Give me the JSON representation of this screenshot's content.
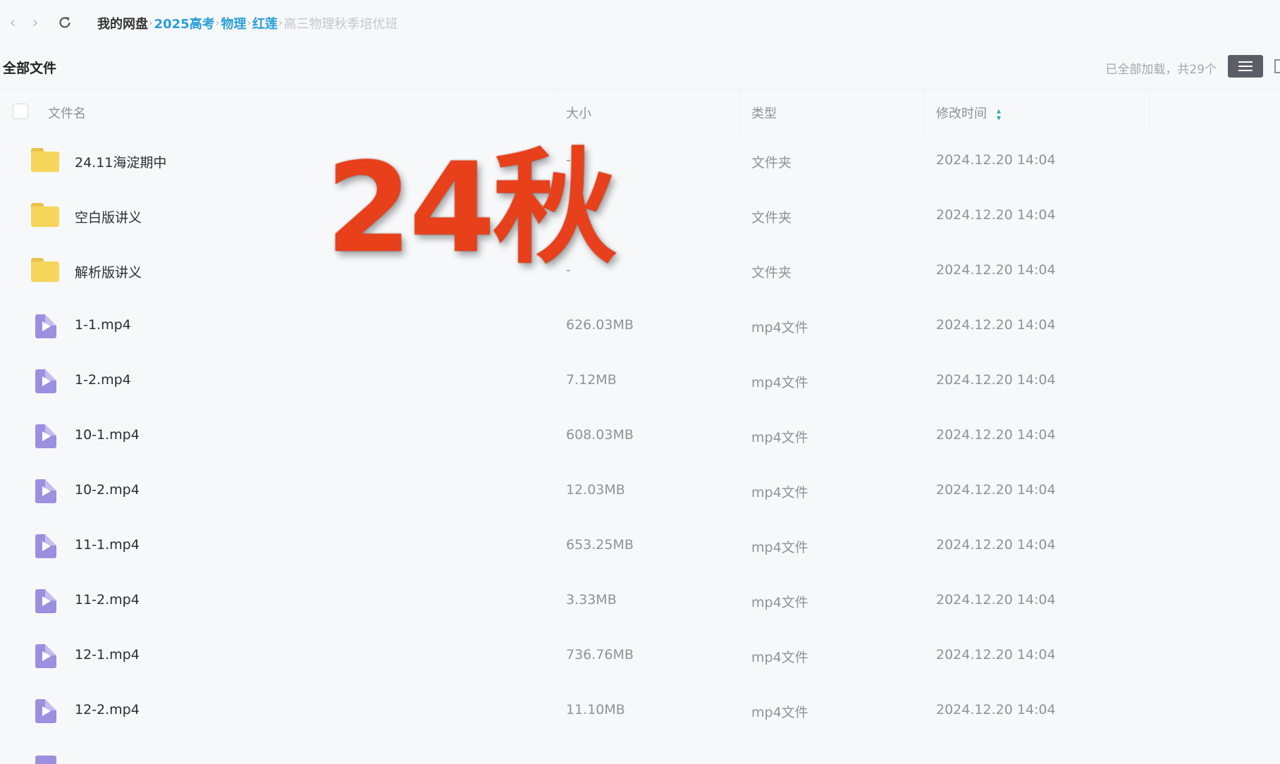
{
  "nav": {
    "back_icon": "chevron-left-icon",
    "forward_icon": "chevron-right-icon",
    "refresh_icon": "refresh-icon"
  },
  "breadcrumb": [
    {
      "label": "我的网盘",
      "style": "root"
    },
    {
      "label": "2025高考",
      "style": "link"
    },
    {
      "label": "物理",
      "style": "link"
    },
    {
      "label": "红莲",
      "style": "link"
    },
    {
      "label": "高三物理秋季培优班",
      "style": "current"
    }
  ],
  "toolbar": {
    "title": "全部文件",
    "load_status": "已全部加载，共29个",
    "view_list_icon": "list-view-icon",
    "view_grid_icon": "grid-view-icon"
  },
  "table": {
    "columns": {
      "name": "文件名",
      "size": "大小",
      "type": "类型",
      "modified": "修改时间"
    },
    "sort_icon": "sort-arrow-icon",
    "rows": [
      {
        "kind": "folder",
        "name": "24.11海淀期中",
        "size": "-",
        "type": "文件夹",
        "modified": "2024.12.20 14:04"
      },
      {
        "kind": "folder",
        "name": "空白版讲义",
        "size": "-",
        "type": "文件夹",
        "modified": "2024.12.20 14:04"
      },
      {
        "kind": "folder",
        "name": "解析版讲义",
        "size": "-",
        "type": "文件夹",
        "modified": "2024.12.20 14:04"
      },
      {
        "kind": "video",
        "name": "1-1.mp4",
        "size": "626.03MB",
        "type": "mp4文件",
        "modified": "2024.12.20 14:04"
      },
      {
        "kind": "video",
        "name": "1-2.mp4",
        "size": "7.12MB",
        "type": "mp4文件",
        "modified": "2024.12.20 14:04"
      },
      {
        "kind": "video",
        "name": "10-1.mp4",
        "size": "608.03MB",
        "type": "mp4文件",
        "modified": "2024.12.20 14:04"
      },
      {
        "kind": "video",
        "name": "10-2.mp4",
        "size": "12.03MB",
        "type": "mp4文件",
        "modified": "2024.12.20 14:04"
      },
      {
        "kind": "video",
        "name": "11-1.mp4",
        "size": "653.25MB",
        "type": "mp4文件",
        "modified": "2024.12.20 14:04"
      },
      {
        "kind": "video",
        "name": "11-2.mp4",
        "size": "3.33MB",
        "type": "mp4文件",
        "modified": "2024.12.20 14:04"
      },
      {
        "kind": "video",
        "name": "12-1.mp4",
        "size": "736.76MB",
        "type": "mp4文件",
        "modified": "2024.12.20 14:04"
      },
      {
        "kind": "video",
        "name": "12-2.mp4",
        "size": "11.10MB",
        "type": "mp4文件",
        "modified": "2024.12.20 14:04"
      }
    ]
  },
  "overlay": {
    "text": "24秋",
    "color": "#e8401a"
  }
}
